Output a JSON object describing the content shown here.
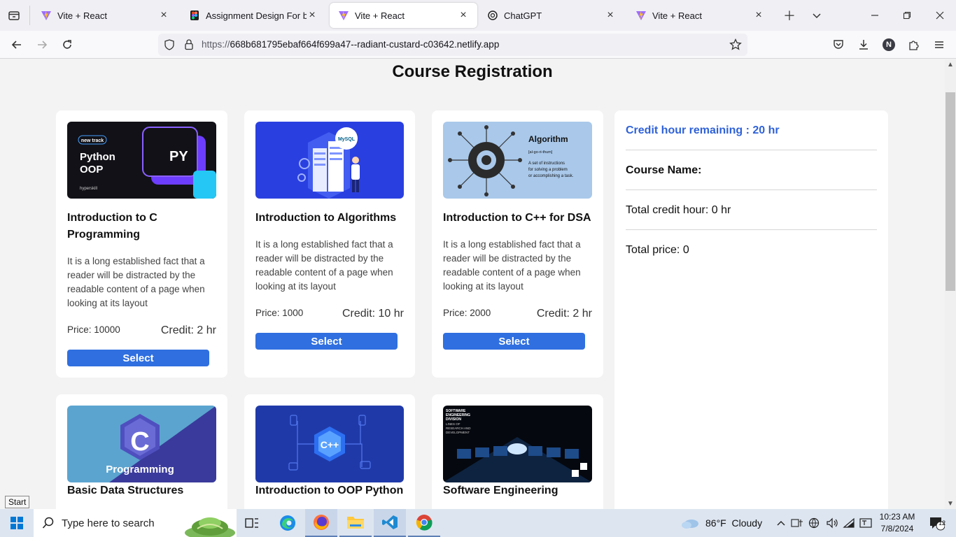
{
  "browser": {
    "tabs": [
      {
        "label": "Vite + React",
        "icon": "vite-icon",
        "active": false
      },
      {
        "label": "Assignment Design For batch",
        "icon": "figma-icon",
        "active": false
      },
      {
        "label": "Vite + React",
        "icon": "vite-icon",
        "active": true
      },
      {
        "label": "ChatGPT",
        "icon": "chatgpt-icon",
        "active": false
      },
      {
        "label": "Vite + React",
        "icon": "vite-icon",
        "active": false
      }
    ],
    "url_prefix": "https://",
    "url_host": "668b681795ebaf664f699a47--radiant-custard-c03642.netlify.app",
    "account_initial": "N"
  },
  "page": {
    "title": "Course Registration",
    "select_label": "Select",
    "courses": [
      {
        "name": "Introduction to C Programming",
        "description": "It is a long established fact that a reader will be distracted by the readable content of a page when looking at its layout",
        "price": "Price: 10000",
        "credit": "Credit: 2 hr",
        "thumb_text": "Python OOP",
        "thumb_badge": "new track",
        "thumb_mark": "PY",
        "thumb_footer": "hyperskill"
      },
      {
        "name": "Introduction to Algorithms",
        "description": "It is a long established fact that a reader will be distracted by the readable content of a page when looking at its layout",
        "price": "Price: 1000",
        "credit": "Credit: 10 hr",
        "thumb_text": "MySQL"
      },
      {
        "name": "Introduction to C++ for DSA",
        "description": "It is a long established fact that a reader will be distracted by the readable content of a page when looking at its layout",
        "price": "Price: 2000",
        "credit": "Credit: 2 hr",
        "thumb_text": "Algorithm",
        "thumb_sub": "[al-go-ri-thum]",
        "thumb_def": "A set of instructions for solving a problem or accomplishing a task."
      },
      {
        "name": "Basic Data Structures",
        "thumb_text": "Programming",
        "thumb_mark": "C"
      },
      {
        "name": "Introduction to OOP Python",
        "thumb_mark": "C++"
      },
      {
        "name": "Software Engineering",
        "thumb_text": "SOFTWARE ENGINEERING DIVISION",
        "thumb_sub": "LINES OF RESEARCH AND DEVELOPMENT"
      }
    ],
    "summary": {
      "remaining": "Credit hour remaining : 20 hr",
      "course_name_heading": "Course Name:",
      "total_credit": "Total credit hour: 0 hr",
      "total_price": "Total price: 0"
    }
  },
  "os": {
    "start_tooltip": "Start",
    "search_placeholder": "Type here to search",
    "weather": "86°F  Cloudy",
    "time": "10:23 AM",
    "date": "7/8/2024",
    "notification_count": "12"
  },
  "colors": {
    "accent": "#2f6fe0",
    "remaining_text": "#2f62d8",
    "page_bg": "#f3f3f3"
  }
}
